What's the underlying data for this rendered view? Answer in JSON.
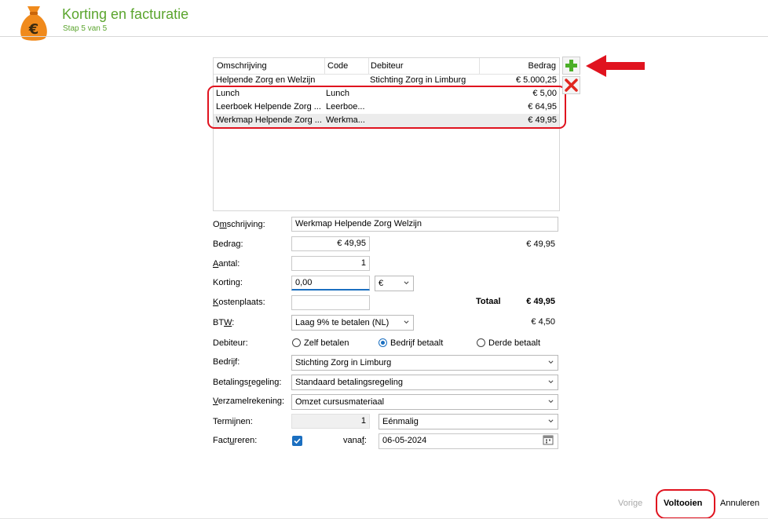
{
  "header": {
    "title": "Korting en facturatie",
    "subtitle": "Stap 5 van 5",
    "icon": "money-bag-euro-icon",
    "accent_color": "#5ba52e"
  },
  "table": {
    "columns": [
      "Omschrijving",
      "Code",
      "Debiteur",
      "Bedrag"
    ],
    "rows": [
      {
        "omschrijving": "Helpende Zorg en Welzijn",
        "code": "",
        "debiteur": "Stichting Zorg in Limburg",
        "bedrag": "€ 5.000,25"
      },
      {
        "omschrijving": "Lunch",
        "code": "Lunch",
        "debiteur": "",
        "bedrag": "€ 5,00"
      },
      {
        "omschrijving": "Leerboek Helpende Zorg ...",
        "code": "Leerboe...",
        "debiteur": "",
        "bedrag": "€ 64,95"
      },
      {
        "omschrijving": "Werkmap Helpende Zorg ...",
        "code": "Werkma...",
        "debiteur": "",
        "bedrag": "€ 49,95"
      }
    ],
    "selected_row": 3
  },
  "toolbar": {
    "add_icon": "plus-icon",
    "delete_icon": "close-icon",
    "annotation_color": "#e0131f"
  },
  "form": {
    "omschrijving": {
      "label_pre": "O",
      "label_u": "m",
      "label_post": "schrijving:",
      "value": "Werkmap Helpende Zorg Welzijn"
    },
    "bedrag": {
      "label_pre": "Bedra",
      "label_u": "g",
      "label_post": ":",
      "value": "€ 49,95",
      "display": "€ 49,95"
    },
    "aantal": {
      "label_pre": "",
      "label_u": "A",
      "label_post": "antal:",
      "value": "1"
    },
    "korting": {
      "label": "Korting:",
      "value": "0,00",
      "unit": "€"
    },
    "kostenplaats": {
      "label_pre": "",
      "label_u": "K",
      "label_post": "ostenplaats:",
      "value": ""
    },
    "totaal": {
      "label": "Totaal",
      "value": "€ 49,95"
    },
    "btw": {
      "label_pre": "BT",
      "label_u": "W",
      "label_post": ":",
      "value": "Laag 9% te betalen (NL)",
      "amount": "€ 4,50"
    },
    "debiteur": {
      "label": "Debiteur:",
      "options": [
        "Zelf betalen",
        "Bedrijf betaalt",
        "Derde betaalt"
      ],
      "selected": "Bedrijf betaalt"
    },
    "bedrijf": {
      "label_pre": "Bedri",
      "label_u": "j",
      "label_post": "f:",
      "value": "Stichting Zorg in Limburg"
    },
    "betalingsregeling": {
      "label_pre": "Betalings",
      "label_u": "r",
      "label_post": "egeling:",
      "value": "Standaard betalingsregeling"
    },
    "verzamelrekening": {
      "label_pre": "",
      "label_u": "V",
      "label_post": "erzamelrekening:",
      "value": "Omzet cursusmateriaal"
    },
    "termijnen": {
      "label_pre": "Termi",
      "label_u": "j",
      "label_post": "nen:",
      "value": "1",
      "frequency": "Eénmalig"
    },
    "factureren": {
      "label_pre": "Fact",
      "label_u": "u",
      "label_post": "reren:",
      "checked": true
    },
    "vanaf": {
      "label_pre": "vana",
      "label_u": "f",
      "label_post": ":",
      "value": "06-05-2024"
    }
  },
  "footer": {
    "prev_label": "Vorige",
    "finish_label": "Voltooien",
    "cancel_label": "Annuleren"
  }
}
